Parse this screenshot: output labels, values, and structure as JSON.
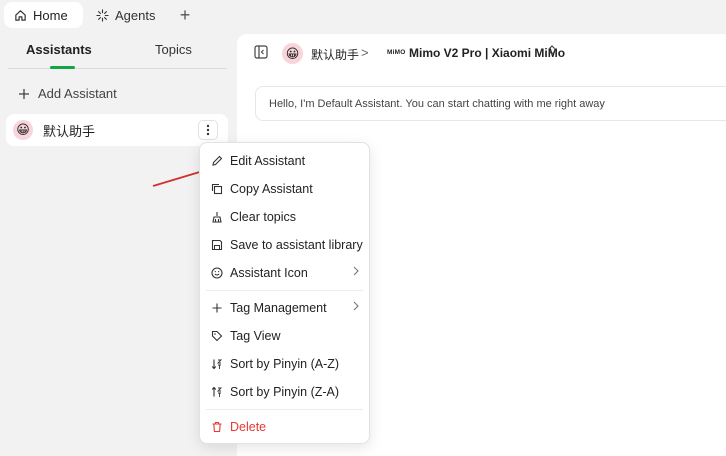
{
  "tabs": {
    "home_label": "Home",
    "agents_label": "Agents",
    "add_symbol": "+"
  },
  "sidebar": {
    "tab_assistants": "Assistants",
    "tab_topics": "Topics",
    "add_assistant_label": "Add Assistant",
    "assistant": {
      "name": "默认助手",
      "avatar_emoji": "😀"
    }
  },
  "header": {
    "assistant_name": "默认助手",
    "breadcrumb_separator": ">",
    "model_logo_text": "MiMO",
    "model_name": "Mimo V2 Pro | Xiaomi MiMo"
  },
  "chat": {
    "greeting": "Hello, I'm Default Assistant. You can start chatting with me right away"
  },
  "context_menu": {
    "items": [
      {
        "label": "Edit Assistant",
        "icon": "pencil-icon"
      },
      {
        "label": "Copy Assistant",
        "icon": "copy-icon"
      },
      {
        "label": "Clear topics",
        "icon": "broom-icon"
      },
      {
        "label": "Save to assistant library",
        "icon": "save-icon"
      },
      {
        "label": "Assistant Icon",
        "icon": "smile-icon",
        "submenu": true
      },
      {
        "label": "Tag Management",
        "icon": "plus-icon",
        "submenu": true
      },
      {
        "label": "Tag View",
        "icon": "tags-icon"
      },
      {
        "label": "Sort by Pinyin (A-Z)",
        "icon": "sort-asc-icon"
      },
      {
        "label": "Sort by Pinyin (Z-A)",
        "icon": "sort-desc-icon"
      },
      {
        "label": "Delete",
        "icon": "trash-icon",
        "danger": true
      }
    ]
  },
  "colors": {
    "accent": "#16a34a",
    "danger": "#e53935",
    "annotation_arrow": "#d32f2f"
  }
}
